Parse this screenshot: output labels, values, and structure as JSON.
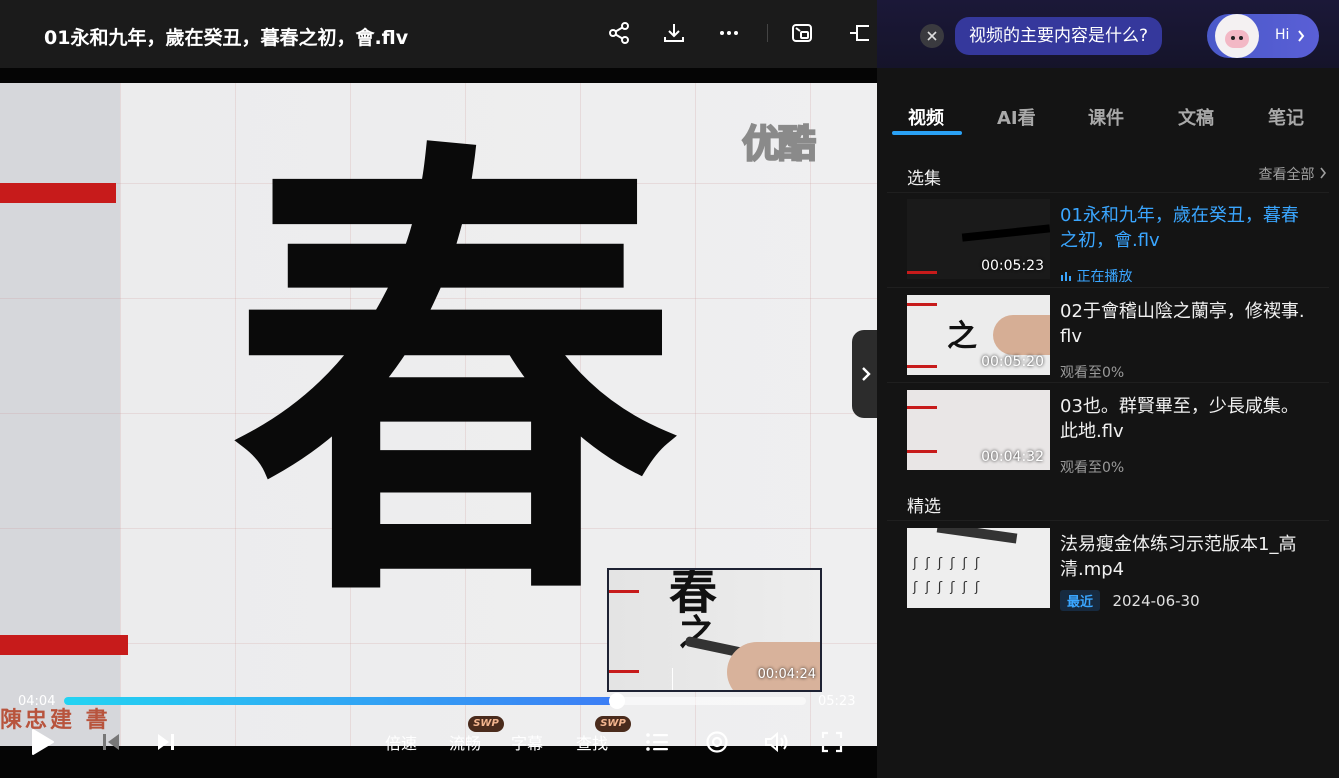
{
  "header": {
    "title": "01永和九年，歲在癸丑，暮春之初，會.flv",
    "icons": [
      "share-icon",
      "download-icon",
      "more-icon",
      "picture-in-picture-icon",
      "collapse-panel-icon"
    ]
  },
  "video": {
    "watermark": "优酷",
    "main_character": "春",
    "signature": "陳忠建 書",
    "preview_time": "00:04:24",
    "current_time": "04:04",
    "total_time": "05:23",
    "progress": 0.745
  },
  "controls": {
    "speed": "倍速",
    "quality": "流畅",
    "subtitles": "字幕",
    "search": "查找",
    "swp_badge": "SWP"
  },
  "ai": {
    "question": "视频的主要内容是什么?",
    "hi_label": "Hi"
  },
  "tabs": [
    {
      "label": "视频",
      "active": true
    },
    {
      "label": "AI看",
      "active": false
    },
    {
      "label": "课件",
      "active": false
    },
    {
      "label": "文稿",
      "active": false
    },
    {
      "label": "笔记",
      "active": false
    }
  ],
  "playlist": {
    "section_title": "选集",
    "see_all": "查看全部",
    "items": [
      {
        "title": "01永和九年，歲在癸丑，暮春之初，會.flv",
        "duration": "00:05:23",
        "status": "正在播放",
        "playing": true
      },
      {
        "title": "02于會稽山陰之蘭亭，修禊事.flv",
        "duration": "00:05:20",
        "status": "观看至0%",
        "playing": false
      },
      {
        "title": "03也。群賢畢至，少長咸集。此地.flv",
        "duration": "00:04:32",
        "status": "观看至0%",
        "playing": false
      }
    ]
  },
  "featured": {
    "section_title": "精选",
    "items": [
      {
        "title": "法易瘦金体练习示范版本1_高清.mp4",
        "tag": "最近",
        "date": "2024-06-30"
      }
    ]
  },
  "colors": {
    "accent": "#2aa1f5",
    "progress_start": "#23d3f2",
    "progress_end": "#3d7df5",
    "panel_bg": "#141414",
    "ai_bubble": "#35389c"
  }
}
